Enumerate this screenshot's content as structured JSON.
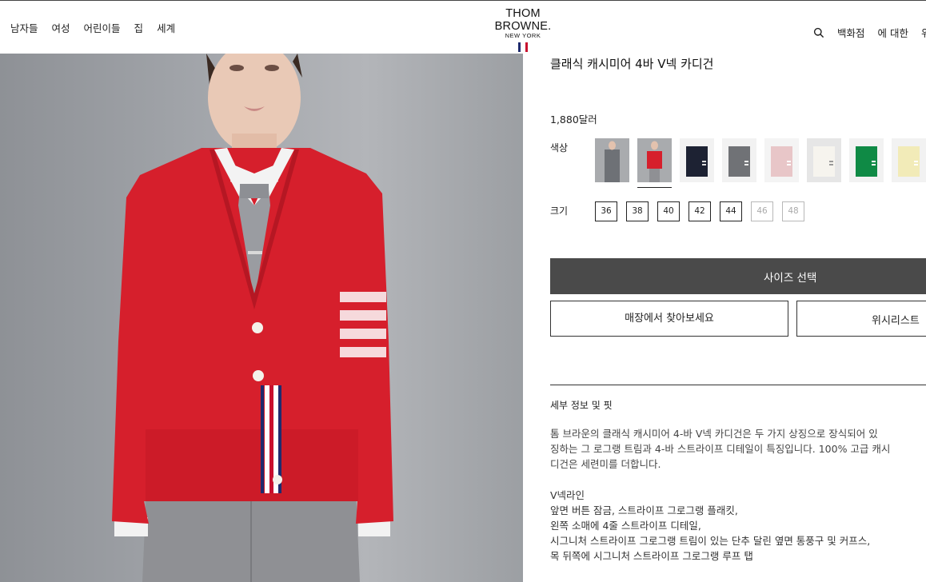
{
  "header": {
    "nav_left": [
      "남자들",
      "여성",
      "어린이들",
      "집",
      "세계"
    ],
    "brand": "THOM BROWNE.",
    "brand_sub": "NEW YORK",
    "nav_right": [
      "백화점",
      "에 대한",
      "위"
    ],
    "icons": [
      "search-icon"
    ],
    "flag_colors": [
      "#1f2b6e",
      "#ffffff",
      "#c8102e"
    ]
  },
  "product": {
    "title": "클래식 캐시미어 4바 V넥 카디건",
    "price": "1,880달러",
    "color_label": "색상",
    "swatches": [
      {
        "name": "grey-suit",
        "color": "#6e7176",
        "selected": false
      },
      {
        "name": "red",
        "color": "#d61f2c",
        "selected": true
      },
      {
        "name": "navy",
        "color": "#1d2233",
        "selected": false
      },
      {
        "name": "grey",
        "color": "#707276",
        "selected": false
      },
      {
        "name": "pink",
        "color": "#e8c6c8",
        "selected": false
      },
      {
        "name": "white",
        "color": "#efede6",
        "selected": false
      },
      {
        "name": "green",
        "color": "#0f8a45",
        "selected": false
      },
      {
        "name": "yellow",
        "color": "#f2ebb8",
        "selected": false
      }
    ],
    "size_label": "크기",
    "sizes": [
      {
        "label": "36",
        "available": true
      },
      {
        "label": "38",
        "available": true
      },
      {
        "label": "40",
        "available": true
      },
      {
        "label": "42",
        "available": true
      },
      {
        "label": "44",
        "available": true
      },
      {
        "label": "46",
        "available": false
      },
      {
        "label": "48",
        "available": false
      }
    ],
    "select_size_button": "사이즈 선택",
    "find_in_store_button": "매장에서 찾아보세요",
    "wishlist_button": "위시리스트",
    "accent_color": "#4a4a4a"
  },
  "details": {
    "section_title": "세부 정보 및 핏",
    "description_lines": [
      "톰 브라운의 클래식 캐시미어 4-바 V넥 카디건은 두 가지 상징으로 장식되어 있",
      "징하는 그 로그랭 트림과 4-바 스트라이프 디테일이 특징입니다. 100% 고급 캐시",
      "디건은 세련미를 더합니다."
    ],
    "features": [
      "V넥라인",
      "앞면 버튼 잠금, 스트라이프 그로그랭 플래킷,",
      "왼쪽 소매에 4줄 스트라이프 디테일,",
      "시그니처 스트라이프 그로그랭 트림이 있는 단추 달린 옆면 통풍구 및 커프스,",
      "목 뒤쪽에 시그니처 스트라이프 그로그랭 루프 탭"
    ]
  }
}
